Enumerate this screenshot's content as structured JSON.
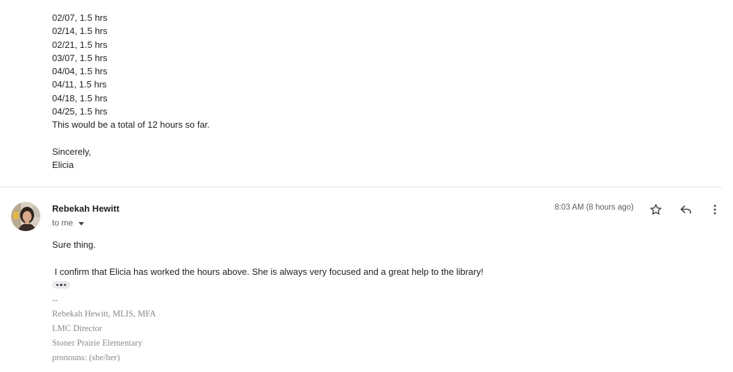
{
  "previous_message": {
    "lines": [
      "02/07, 1.5 hrs",
      "02/14, 1.5 hrs",
      "02/21, 1.5 hrs",
      "03/07, 1.5 hrs",
      "04/04, 1.5 hrs",
      "04/11, 1.5 hrs",
      "04/18, 1.5 hrs",
      "04/25, 1.5 hrs"
    ],
    "total": "This would be a total of 12 hours so far.",
    "closing": "Sincerely,",
    "signature": "Elicia"
  },
  "reply": {
    "sender_name": "Rebekah Hewitt",
    "recipient": "to me",
    "timestamp": "8:03 AM (8 hours ago)",
    "greeting": "Sure thing.",
    "body": " I confirm that Elicia has worked the hours above. She is always very focused and a great help to the library!",
    "signature": {
      "separator": "--",
      "name": "Rebekah Hewitt, MLIS, MFA",
      "title": "LMC Director",
      "school": "Stoner Prairie Elementary",
      "pronouns": "pronouns: (she/her)"
    }
  },
  "icons": {
    "star": "star-icon",
    "reply": "reply-icon",
    "more": "more-vert-icon",
    "expand": "show-trimmed-content-icon",
    "avatar": "sender-avatar"
  }
}
